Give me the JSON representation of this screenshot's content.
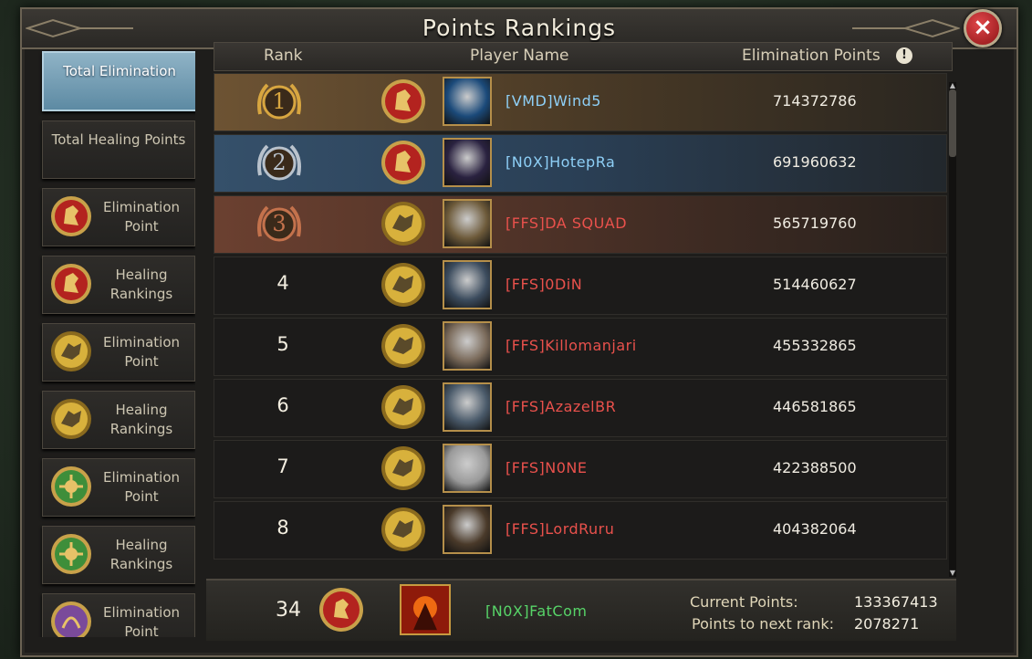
{
  "window": {
    "title": "Points Rankings"
  },
  "sidebar": {
    "items": [
      {
        "label": "Total Elimination",
        "active": true,
        "emblem": ""
      },
      {
        "label": "Total Healing Points",
        "active": false,
        "emblem": ""
      },
      {
        "label": "Elimination Point",
        "active": false,
        "emblem": "lion-red-icon"
      },
      {
        "label": "Healing Rankings",
        "active": false,
        "emblem": "lion-red-icon"
      },
      {
        "label": "Elimination Point",
        "active": false,
        "emblem": "wolf-gold-icon"
      },
      {
        "label": "Healing Rankings",
        "active": false,
        "emblem": "wolf-gold-icon"
      },
      {
        "label": "Elimination Point",
        "active": false,
        "emblem": "flower-green-icon"
      },
      {
        "label": "Healing Rankings",
        "active": false,
        "emblem": "flower-green-icon"
      },
      {
        "label": "Elimination Point",
        "active": false,
        "emblem": "dragon-purple-icon"
      }
    ]
  },
  "table": {
    "headers": {
      "rank": "Rank",
      "name": "Player Name",
      "points": "Elimination Points"
    },
    "rows": [
      {
        "rank": "1",
        "name": "[VMD]Wind5",
        "points": "714372786",
        "house": "lion",
        "name_color": "blue",
        "style": "gold"
      },
      {
        "rank": "2",
        "name": "[N0X]HotepRa",
        "points": "691960632",
        "house": "lion",
        "name_color": "blue",
        "style": "silver"
      },
      {
        "rank": "3",
        "name": "[FFS]DA SQUAD",
        "points": "565719760",
        "house": "wolf",
        "name_color": "red",
        "style": "bronze"
      },
      {
        "rank": "4",
        "name": "[FFS]0DiN",
        "points": "514460627",
        "house": "wolf",
        "name_color": "red",
        "style": ""
      },
      {
        "rank": "5",
        "name": "[FFS]Killomanjari",
        "points": "455332865",
        "house": "wolf",
        "name_color": "red",
        "style": ""
      },
      {
        "rank": "6",
        "name": "[FFS]AzazelBR",
        "points": "446581865",
        "house": "wolf",
        "name_color": "red",
        "style": ""
      },
      {
        "rank": "7",
        "name": "[FFS]N0NE",
        "points": "422388500",
        "house": "wolf",
        "name_color": "red",
        "style": ""
      },
      {
        "rank": "8",
        "name": "[FFS]LordRuru",
        "points": "404382064",
        "house": "wolf",
        "name_color": "red",
        "style": ""
      }
    ]
  },
  "footer": {
    "rank": "34",
    "name": "[N0X]FatCom",
    "current_label": "Current Points:",
    "current_value": "133367413",
    "next_label": "Points to next rank:",
    "next_value": "2078271"
  },
  "colors": {
    "lion_house": "#b3231f",
    "wolf_house": "#c9a233",
    "flower_house": "#3e8e3a",
    "dragon_house": "#7a4a9a",
    "name_blue": "#8ecff6",
    "name_red": "#e9514c",
    "name_green": "#57d468"
  }
}
